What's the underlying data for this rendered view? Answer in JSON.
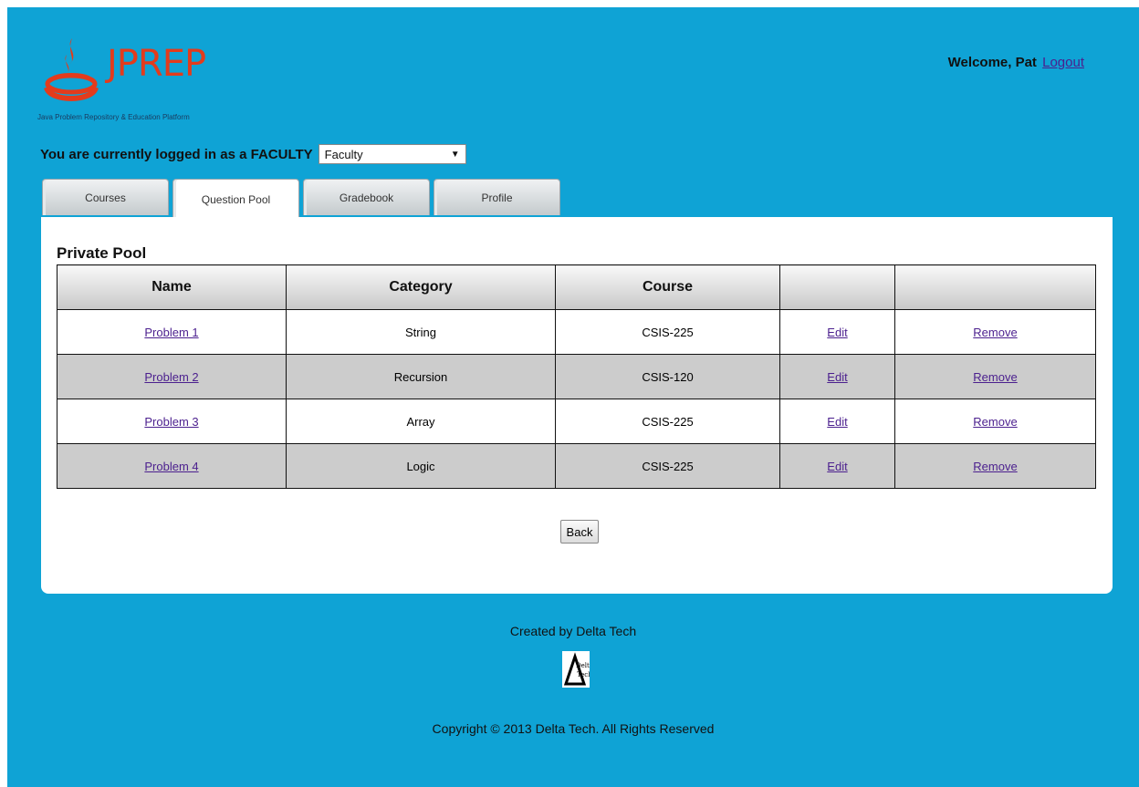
{
  "header": {
    "logo_text": "JPREP",
    "tagline": "Java Problem Repository & Education Platform",
    "welcome_text": "Welcome, Pat",
    "logout_label": "Logout"
  },
  "role": {
    "label": "You are currently logged in as a FACULTY",
    "selected": "Faculty"
  },
  "tabs": [
    {
      "label": "Courses",
      "active": false
    },
    {
      "label": "Question Pool",
      "active": true
    },
    {
      "label": "Gradebook",
      "active": false
    },
    {
      "label": "Profile",
      "active": false
    }
  ],
  "pool": {
    "title": "Private Pool",
    "columns": [
      "Name",
      "Category",
      "Course",
      "",
      ""
    ],
    "rows": [
      {
        "name": "Problem 1",
        "category": "String",
        "course": "CSIS-225",
        "edit": "Edit",
        "remove": "Remove"
      },
      {
        "name": "Problem 2",
        "category": "Recursion",
        "course": "CSIS-120",
        "edit": "Edit",
        "remove": "Remove"
      },
      {
        "name": "Problem 3",
        "category": "Array",
        "course": "CSIS-225",
        "edit": "Edit",
        "remove": "Remove"
      },
      {
        "name": "Problem 4",
        "category": "Logic",
        "course": "CSIS-225",
        "edit": "Edit",
        "remove": "Remove"
      }
    ],
    "back_label": "Back"
  },
  "footer": {
    "created_by": "Created by Delta Tech",
    "logo_text": "Delta Tech",
    "copyright": "Copyright © 2013 Delta Tech. All Rights Reserved"
  },
  "colors": {
    "background": "#0fa3d5",
    "brand": "#e33b1c",
    "link": "#4b1f8e"
  }
}
